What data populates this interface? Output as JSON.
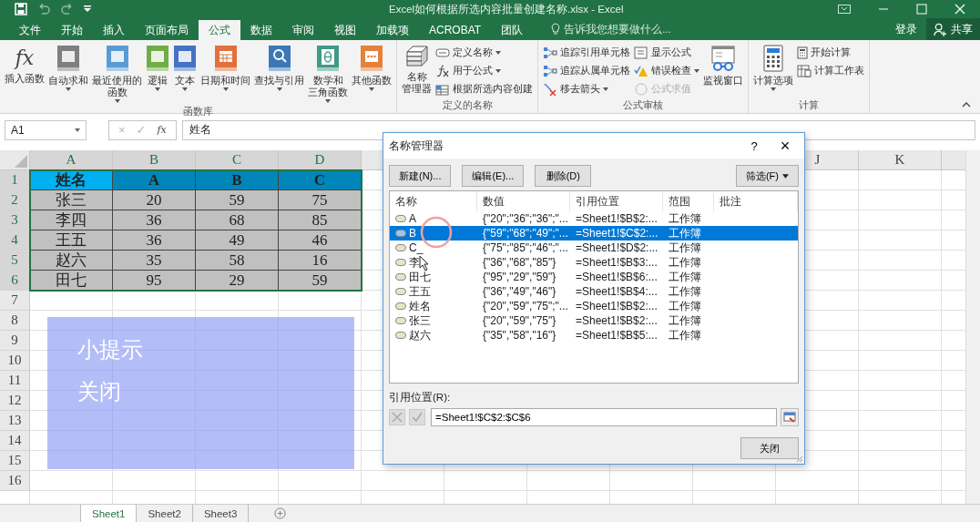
{
  "title_bar": {
    "title": "Excel如何根据所选内容批量创建名称.xlsx - Excel"
  },
  "ribbon_tabs": [
    {
      "label": "文件",
      "selected": false
    },
    {
      "label": "开始",
      "selected": false
    },
    {
      "label": "插入",
      "selected": false
    },
    {
      "label": "页面布局",
      "selected": false
    },
    {
      "label": "公式",
      "selected": true
    },
    {
      "label": "数据",
      "selected": false
    },
    {
      "label": "审阅",
      "selected": false
    },
    {
      "label": "视图",
      "selected": false
    },
    {
      "label": "加载项",
      "selected": false
    },
    {
      "label": "ACROBAT",
      "selected": false
    },
    {
      "label": "团队",
      "selected": false
    }
  ],
  "tell_me": {
    "placeholder": "告诉我您想要做什么..."
  },
  "account": {
    "sign_in": "登录",
    "share": "共享"
  },
  "ribbon_groups": [
    {
      "title": "函数库",
      "items": [
        {
          "kind": "large",
          "glyph": "fx",
          "lines": [
            "插入函数"
          ],
          "caret": false
        },
        {
          "kind": "large",
          "lines": [
            "自动求和"
          ],
          "caret": true
        },
        {
          "kind": "large",
          "lines": [
            "最近使用的",
            "函数"
          ],
          "caret": true
        },
        {
          "kind": "large",
          "lines": [
            "逻辑"
          ],
          "caret": true
        },
        {
          "kind": "large",
          "lines": [
            "文本"
          ],
          "caret": true
        },
        {
          "kind": "large",
          "lines": [
            "日期和时间"
          ],
          "caret": true
        },
        {
          "kind": "large",
          "lines": [
            "查找与引用"
          ],
          "caret": true
        },
        {
          "kind": "large",
          "lines": [
            "数学和",
            "三角函数"
          ],
          "caret": true
        },
        {
          "kind": "large",
          "lines": [
            "其他函数"
          ],
          "caret": true
        }
      ]
    },
    {
      "title": "定义的名称",
      "items": [
        {
          "kind": "large",
          "lines": [
            "名称",
            "管理器"
          ],
          "caret": false
        },
        {
          "kind": "stack",
          "items": [
            {
              "label": "定义名称",
              "caret": true,
              "disabled": false
            },
            {
              "label": "用于公式",
              "caret": true,
              "disabled": false
            },
            {
              "label": "根据所选内容创建",
              "caret": false,
              "disabled": false
            }
          ]
        }
      ]
    },
    {
      "title": "公式审核",
      "items": [
        {
          "kind": "stack",
          "items": [
            {
              "label": "追踪引用单元格",
              "caret": false,
              "disabled": false
            },
            {
              "label": "追踪从属单元格",
              "caret": false,
              "disabled": false
            },
            {
              "label": "移去箭头",
              "caret": true,
              "disabled": false
            }
          ]
        },
        {
          "kind": "stack",
          "items": [
            {
              "label": "显示公式",
              "caret": false,
              "disabled": false
            },
            {
              "label": "错误检查",
              "caret": true,
              "disabled": false
            },
            {
              "label": "公式求值",
              "caret": false,
              "disabled": true
            }
          ]
        },
        {
          "kind": "large",
          "lines": [
            "监视窗口"
          ],
          "caret": false
        }
      ]
    },
    {
      "title": "计算",
      "items": [
        {
          "kind": "large",
          "lines": [
            "计算选项"
          ],
          "caret": true
        },
        {
          "kind": "stack",
          "items": [
            {
              "label": "开始计算",
              "caret": false,
              "disabled": false
            },
            {
              "label": "计算工作表",
              "caret": false,
              "disabled": false
            }
          ]
        }
      ]
    }
  ],
  "formula_bar": {
    "name_box": "A1",
    "cancel": "×",
    "enter": "✓",
    "fx": "fx",
    "value": "姓名"
  },
  "sheet": {
    "columns": [
      {
        "letter": "A",
        "selected": true,
        "gap_before": false
      },
      {
        "letter": "B",
        "selected": true,
        "gap_before": false
      },
      {
        "letter": "C",
        "selected": true,
        "gap_before": false
      },
      {
        "letter": "D",
        "selected": true,
        "gap_before": false
      },
      {
        "letter": "J",
        "selected": false,
        "gap_before": true
      },
      {
        "letter": "K",
        "selected": false,
        "gap_before": false
      }
    ],
    "rows": [
      {
        "header": "1",
        "selected": true,
        "cells": [
          {
            "kind": "key",
            "text": "姓名"
          },
          {
            "kind": "head",
            "text": "A"
          },
          {
            "kind": "head",
            "text": "B"
          },
          {
            "kind": "head",
            "text": "C"
          }
        ]
      },
      {
        "header": "2",
        "selected": true,
        "cells": [
          {
            "kind": "data",
            "text": "张三"
          },
          {
            "kind": "data",
            "text": "20"
          },
          {
            "kind": "data",
            "text": "59"
          },
          {
            "kind": "data",
            "text": "75"
          }
        ]
      },
      {
        "header": "3",
        "selected": true,
        "cells": [
          {
            "kind": "data",
            "text": "李四"
          },
          {
            "kind": "data",
            "text": "36"
          },
          {
            "kind": "data",
            "text": "68"
          },
          {
            "kind": "data",
            "text": "85"
          }
        ]
      },
      {
        "header": "4",
        "selected": true,
        "cells": [
          {
            "kind": "data",
            "text": "王五"
          },
          {
            "kind": "data",
            "text": "36"
          },
          {
            "kind": "data",
            "text": "49"
          },
          {
            "kind": "data",
            "text": "46"
          }
        ]
      },
      {
        "header": "5",
        "selected": true,
        "cells": [
          {
            "kind": "data",
            "text": "赵六"
          },
          {
            "kind": "data",
            "text": "35"
          },
          {
            "kind": "data",
            "text": "58"
          },
          {
            "kind": "data",
            "text": "16"
          }
        ]
      },
      {
        "header": "6",
        "selected": true,
        "cells": [
          {
            "kind": "data",
            "text": "田七"
          },
          {
            "kind": "data",
            "text": "95"
          },
          {
            "kind": "data",
            "text": "29"
          },
          {
            "kind": "data",
            "text": "59"
          }
        ]
      },
      {
        "header": "7",
        "selected": false,
        "cells": []
      },
      {
        "header": "8",
        "selected": false,
        "cells": []
      },
      {
        "header": "9",
        "selected": false,
        "cells": []
      },
      {
        "header": "10",
        "selected": false,
        "cells": []
      },
      {
        "header": "11",
        "selected": false,
        "cells": []
      },
      {
        "header": "12",
        "selected": false,
        "cells": []
      },
      {
        "header": "13",
        "selected": false,
        "cells": []
      },
      {
        "header": "14",
        "selected": false,
        "cells": []
      },
      {
        "header": "15",
        "selected": false,
        "cells": []
      },
      {
        "header": "16",
        "selected": false,
        "cells": []
      }
    ]
  },
  "sheet_tabs": [
    {
      "label": "Sheet1",
      "selected": true
    },
    {
      "label": "Sheet2",
      "selected": false
    },
    {
      "label": "Sheet3",
      "selected": false
    }
  ],
  "tip_overlay": {
    "title": "小提示",
    "close": "关闭"
  },
  "name_manager": {
    "title": "名称管理器",
    "help": "?",
    "close": "×",
    "buttons": [
      {
        "label": "新建(N)..."
      },
      {
        "label": "编辑(E)..."
      },
      {
        "label": "删除(D)"
      }
    ],
    "filter": {
      "label": "筛选(F)"
    },
    "columns": [
      "名称",
      "数值",
      "引用位置",
      "范围",
      "批注"
    ],
    "rows": [
      {
        "name": "A",
        "value": "{\"20\";\"36\";\"36\";\"...",
        "ref": "=Sheet1!$B$2:...",
        "scope": "工作簿",
        "selected": false
      },
      {
        "name": "B",
        "value": "{\"59\";\"68\";\"49\";\"...",
        "ref": "=Sheet1!$C$2:...",
        "scope": "工作簿",
        "selected": true
      },
      {
        "name": "C_",
        "value": "{\"75\";\"85\";\"46\";\"...",
        "ref": "=Sheet1!$D$2:...",
        "scope": "工作簿",
        "selected": false
      },
      {
        "name": "李",
        "value": "{\"36\",\"68\",\"85\"}",
        "ref": "=Sheet1!$B$3:...",
        "scope": "工作簿",
        "selected": false
      },
      {
        "name": "田七",
        "value": "{\"95\",\"29\",\"59\"}",
        "ref": "=Sheet1!$B$6:...",
        "scope": "工作簿",
        "selected": false
      },
      {
        "name": "王五",
        "value": "{\"36\",\"49\",\"46\"}",
        "ref": "=Sheet1!$B$4:...",
        "scope": "工作簿",
        "selected": false
      },
      {
        "name": "姓名",
        "value": "{\"20\",\"59\",\"75\";\"...",
        "ref": "=Sheet1!$B$2:...",
        "scope": "工作簿",
        "selected": false
      },
      {
        "name": "张三",
        "value": "{\"20\",\"59\",\"75\"}",
        "ref": "=Sheet1!$B$2:...",
        "scope": "工作簿",
        "selected": false
      },
      {
        "name": "赵六",
        "value": "{\"35\",\"58\",\"16\"}",
        "ref": "=Sheet1!$B$5:...",
        "scope": "工作簿",
        "selected": false
      }
    ],
    "ref_label": "引用位置(R):",
    "ref_value": "=Sheet1!$C$2:$C$6",
    "close_button": "关闭"
  }
}
